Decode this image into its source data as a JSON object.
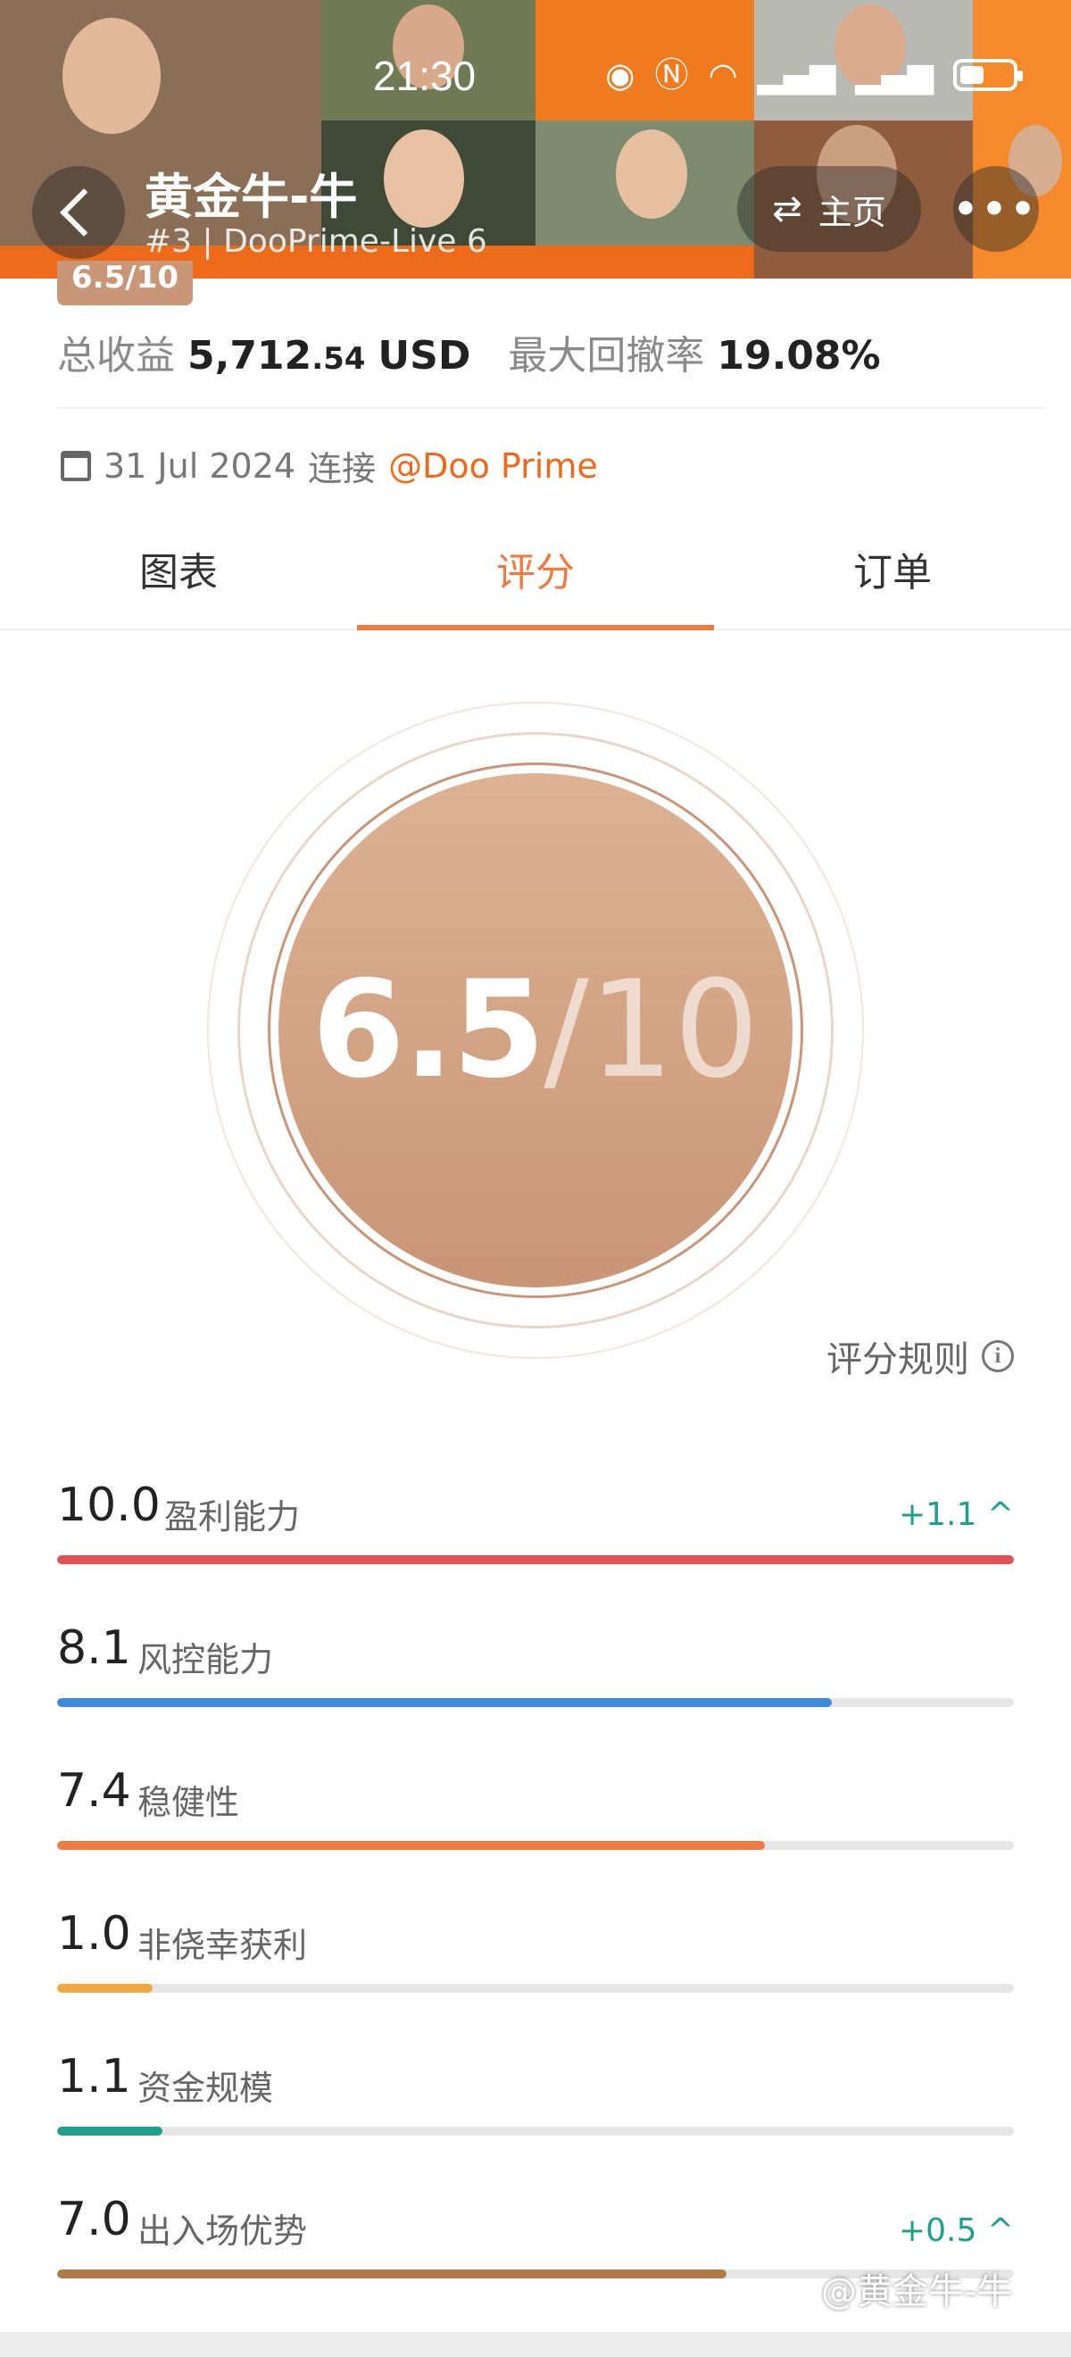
{
  "status_bar": {
    "time": "21:30"
  },
  "header": {
    "name": "黄金牛-牛",
    "subtitle": "#3 | DooPrime-Live 6",
    "home_label": "主页",
    "more_label": "•••"
  },
  "score_chip": "6.5/10",
  "stats": {
    "profit_label": "总收益",
    "profit_main": "5,712",
    "profit_cents": ".54",
    "profit_unit": "USD",
    "drawdown_label": "最大回撤率",
    "drawdown_value": "19.08%"
  },
  "connection": {
    "date": "31 Jul 2024",
    "text": "连接",
    "broker": "@Doo Prime"
  },
  "tabs": [
    {
      "label": "图表"
    },
    {
      "label": "评分"
    },
    {
      "label": "订单"
    }
  ],
  "score": {
    "value": "6.5",
    "max": "/10"
  },
  "rules_label": "评分规则",
  "metrics": [
    {
      "value": "10.0",
      "label": "盈利能力",
      "delta": "+1.1 ^",
      "fraction": 1.0,
      "color": "#e05055"
    },
    {
      "value": "8.1",
      "label": "风控能力",
      "delta": "",
      "fraction": 0.81,
      "color": "#3a8bdc"
    },
    {
      "value": "7.4",
      "label": "稳健性",
      "delta": "",
      "fraction": 0.74,
      "color": "#ee7a45"
    },
    {
      "value": "1.0",
      "label": "非侥幸获利",
      "delta": "",
      "fraction": 0.1,
      "color": "#f0a93e"
    },
    {
      "value": "1.1",
      "label": "资金规模",
      "delta": "",
      "fraction": 0.11,
      "color": "#1fa08a"
    },
    {
      "value": "7.0",
      "label": "出入场优势",
      "delta": "+0.5 ^",
      "fraction": 0.7,
      "color": "#b07a45"
    }
  ],
  "watermark": "@黄金牛-牛"
}
